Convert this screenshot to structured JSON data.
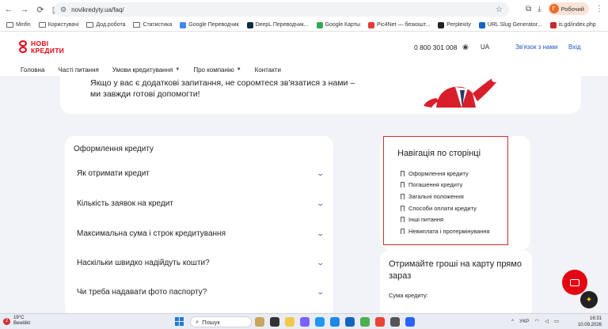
{
  "browser": {
    "url": "novikredyty.ua/faq/",
    "profile_label": "Робочий",
    "profile_initial": "Г",
    "bookmarks": [
      "Minfin",
      "Користувачі",
      "Дод.робота",
      "Статистика",
      "Google Переводчик",
      "DeepL Переводчик...",
      "Google Карты",
      "Pic4Net — безкошт...",
      "Perplexity",
      "URL Slug Generator...",
      "is.gd/index.php"
    ]
  },
  "site": {
    "logo_line1": "НОВІ",
    "logo_line2": "КРЕДИТИ",
    "phone": "0 800 301 008",
    "lang": "UA",
    "contact_link": "Зв'язок з нами",
    "login": "Вхід",
    "menu": [
      {
        "label": "Головна"
      },
      {
        "label": "Часті питання"
      },
      {
        "label": "Умови кредитування"
      },
      {
        "label": "Про компанію"
      },
      {
        "label": "Контакти"
      }
    ]
  },
  "hero": {
    "text": "Якщо у вас є додаткові запитання, не соромтеся зв'язатися з нами – ми завжди готові допомогти!"
  },
  "faq": {
    "section_title": "Оформлення кредиту",
    "items": [
      "Як отримати кредит",
      "Кількість заявок на кредит",
      "Максимальна сума і строк кредитування",
      "Наскільки швидко надійдуть кошти?",
      "Чи треба надавати фото паспорту?"
    ]
  },
  "page_nav": {
    "title": "Навігація по сторінці",
    "links": [
      "Оформлення кредиту",
      "Погашення кредиту",
      "Загальні положення",
      "Способи оплати кредиту",
      "Інші питання",
      "Невиплата і протермінування"
    ]
  },
  "money": {
    "title": "Отримайте гроші на карту прямо зараз",
    "amount_label": "Сума кредиту:"
  },
  "taskbar": {
    "weather_badge": "2",
    "temp": "19°C",
    "weather": "Bewölkt",
    "search": "Пошук",
    "keyboard": "УКР",
    "time": "16:31",
    "date": "10.09.2026"
  },
  "colors": {
    "brand": "#e30613",
    "link": "#1a56c8",
    "nav_border": "#d62d2d"
  }
}
